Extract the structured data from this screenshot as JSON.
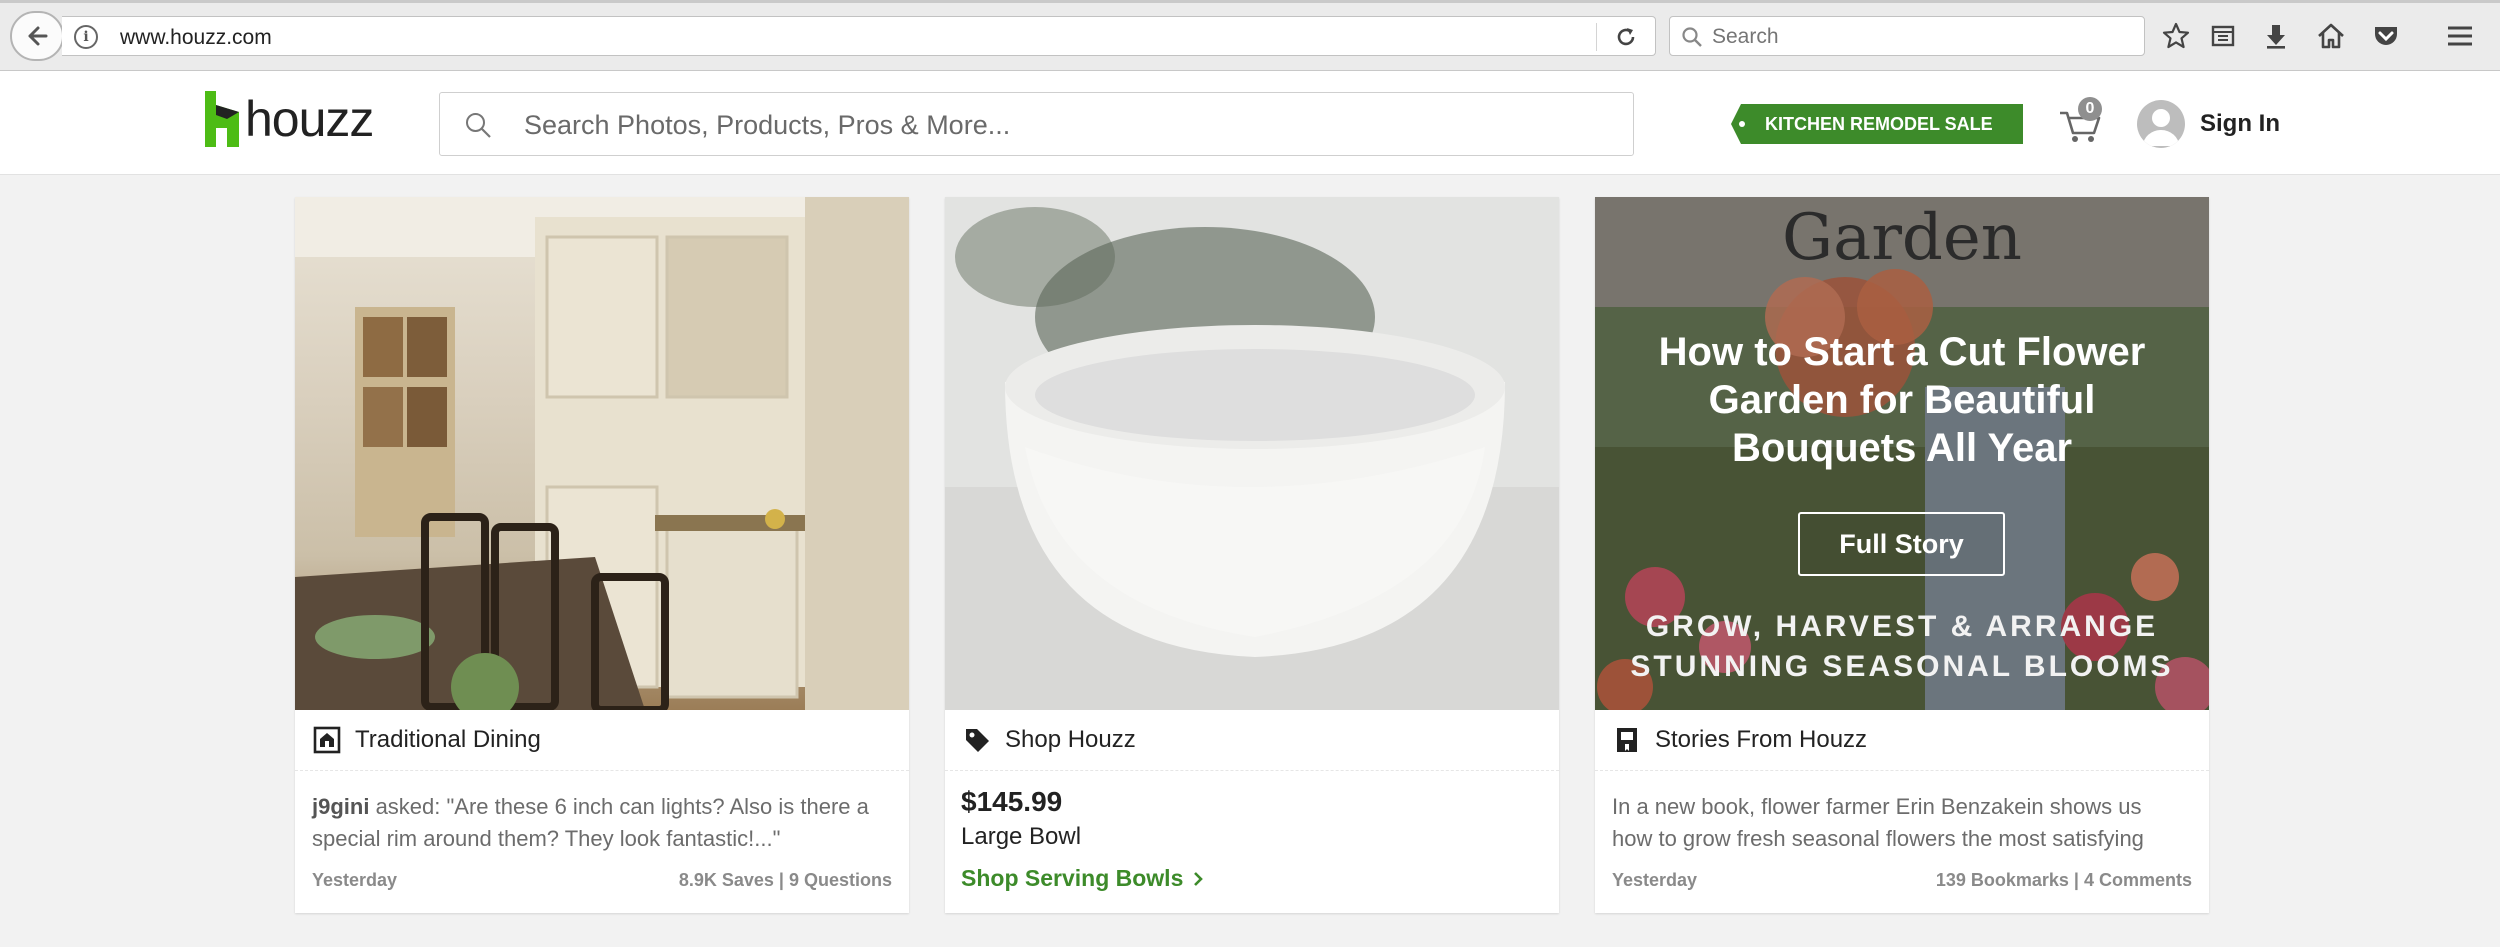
{
  "browser": {
    "url": "www.houzz.com",
    "search_placeholder": "Search"
  },
  "header": {
    "logo_text": "houzz",
    "search_placeholder": "Search Photos, Products, Pros & More...",
    "promo_label": "KITCHEN REMODEL SALE",
    "cart_count": "0",
    "sign_in_label": "Sign In"
  },
  "colors": {
    "brand_green": "#3d8b2a",
    "text_dark": "#222222",
    "text_muted": "#6c6c6c"
  },
  "cards": [
    {
      "category": "Traditional Dining",
      "category_icon": "house-photo-icon",
      "author": "j9gini",
      "body_line1": " asked: \"Are these 6 inch can lights? Also is there a",
      "body_line2": "special rim around them? They look fantastic!...\"",
      "date": "Yesterday",
      "stats": "8.9K Saves | 9 Questions"
    },
    {
      "category": "Shop Houzz",
      "category_icon": "tag-icon",
      "price": "$145.99",
      "product_name": "Large Bowl",
      "link_label": "Shop Serving Bowls"
    },
    {
      "category": "Stories From Houzz",
      "category_icon": "book-icon",
      "image_top_word": "Garden",
      "image_title": "How to Start a Cut Flower Garden for Beautiful Bouquets All Year",
      "image_button": "Full Story",
      "image_sub_line1": "GROW, HARVEST & ARRANGE",
      "image_sub_line2": "STUNNING SEASONAL BLOOMS",
      "body_line1": "In a new book, flower farmer Erin Benzakein shows us",
      "body_line2": "how to grow fresh seasonal flowers the most satisfying",
      "date": "Yesterday",
      "stats": "139 Bookmarks | 4 Comments"
    }
  ]
}
